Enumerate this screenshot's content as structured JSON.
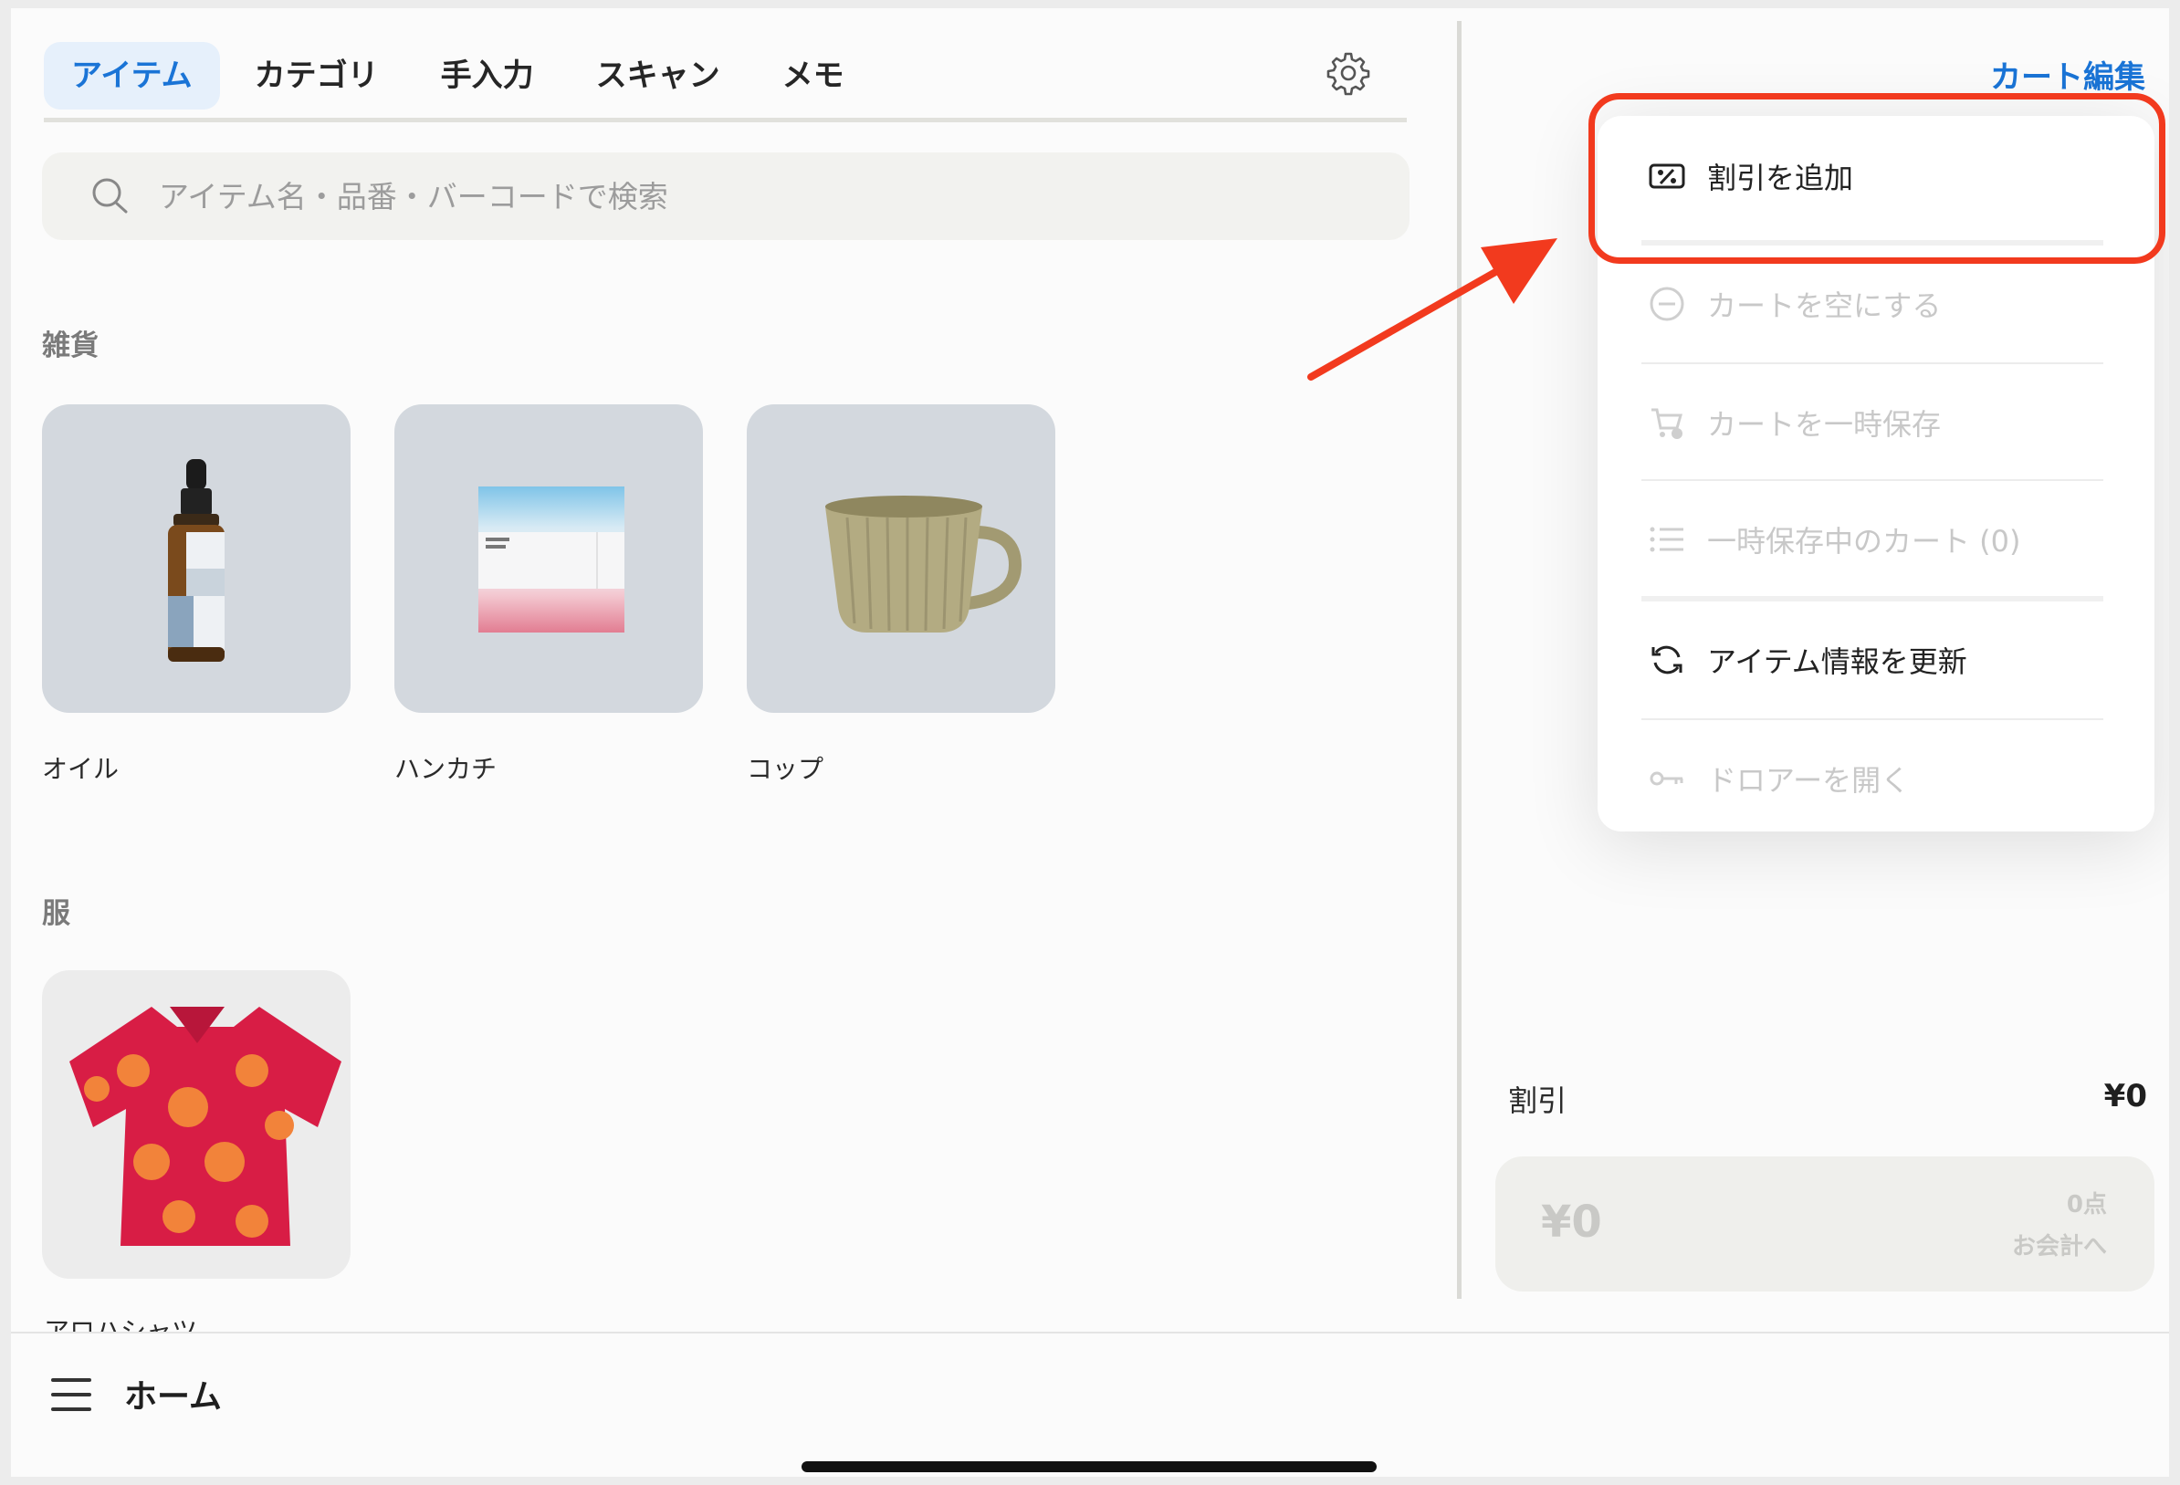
{
  "tabs": [
    {
      "label": "アイテム",
      "active": true
    },
    {
      "label": "カテゴリ",
      "active": false
    },
    {
      "label": "手入力",
      "active": false
    },
    {
      "label": "スキャン",
      "active": false
    },
    {
      "label": "メモ",
      "active": false
    }
  ],
  "icons": {
    "settings": "gear-icon",
    "search": "search-icon",
    "menu": "hamburger-icon"
  },
  "search": {
    "placeholder": "アイテム名・品番・バーコードで検索"
  },
  "sections": [
    {
      "title": "雑貨",
      "items": [
        {
          "label": "オイル",
          "image": "oil-bottle"
        },
        {
          "label": "ハンカチ",
          "image": "handkerchief"
        },
        {
          "label": "コップ",
          "image": "cup"
        }
      ]
    },
    {
      "title": "服",
      "items": [
        {
          "label": "アロハシャツ",
          "image": "aloha-shirt"
        }
      ]
    }
  ],
  "bottom_bar": {
    "title": "ホーム"
  },
  "cart": {
    "edit_label": "カート編集",
    "menu": [
      {
        "label": "割引を追加",
        "icon": "discount-icon",
        "enabled": true
      },
      {
        "label": "カートを空にする",
        "icon": "minus-circle-icon",
        "enabled": false
      },
      {
        "label": "カートを一時保存",
        "icon": "cart-save-icon",
        "enabled": false
      },
      {
        "label": "一時保存中のカート (0)",
        "icon": "list-icon",
        "enabled": false
      },
      {
        "label": "アイテム情報を更新",
        "icon": "refresh-icon",
        "enabled": true
      },
      {
        "label": "ドロアーを開く",
        "icon": "key-icon",
        "enabled": false
      }
    ],
    "discount_label": "割引",
    "discount_value": "¥0",
    "checkout": {
      "amount": "¥0",
      "count": "0点",
      "label": "お会計へ"
    }
  },
  "colors": {
    "accent": "#1a74d6",
    "highlight": "#f23a1e",
    "disabled": "#c8c8c8"
  }
}
